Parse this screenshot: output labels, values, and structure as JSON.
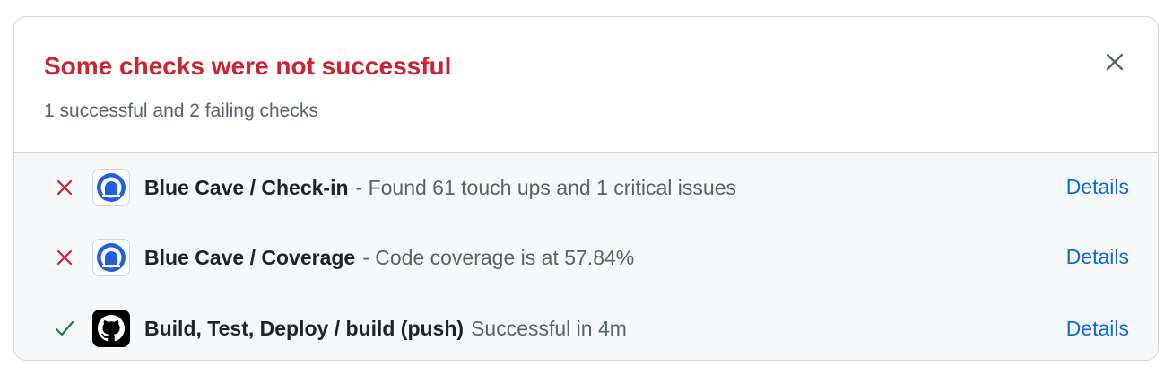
{
  "header": {
    "title": "Some checks were not successful",
    "subtitle": "1 successful and 2 failing checks",
    "close_icon": "close-icon"
  },
  "colors": {
    "fail": "#cf222e",
    "success": "#1a7f37",
    "link": "#0969da",
    "muted": "#59636e",
    "row_bg": "#f6f8fa"
  },
  "checks": [
    {
      "status": "failing",
      "status_icon": "x-icon",
      "app_icon": "blue-cave-icon",
      "name": "Blue Cave / Check-in",
      "description": "- Found 61 touch ups and 1 critical issues",
      "link_label": "Details"
    },
    {
      "status": "failing",
      "status_icon": "x-icon",
      "app_icon": "blue-cave-icon",
      "name": "Blue Cave / Coverage",
      "description": "- Code coverage is at 57.84%",
      "link_label": "Details"
    },
    {
      "status": "successful",
      "status_icon": "check-icon",
      "app_icon": "github-icon",
      "name": "Build, Test, Deploy / build (push)",
      "description": "Successful in 4m",
      "link_label": "Details"
    }
  ]
}
